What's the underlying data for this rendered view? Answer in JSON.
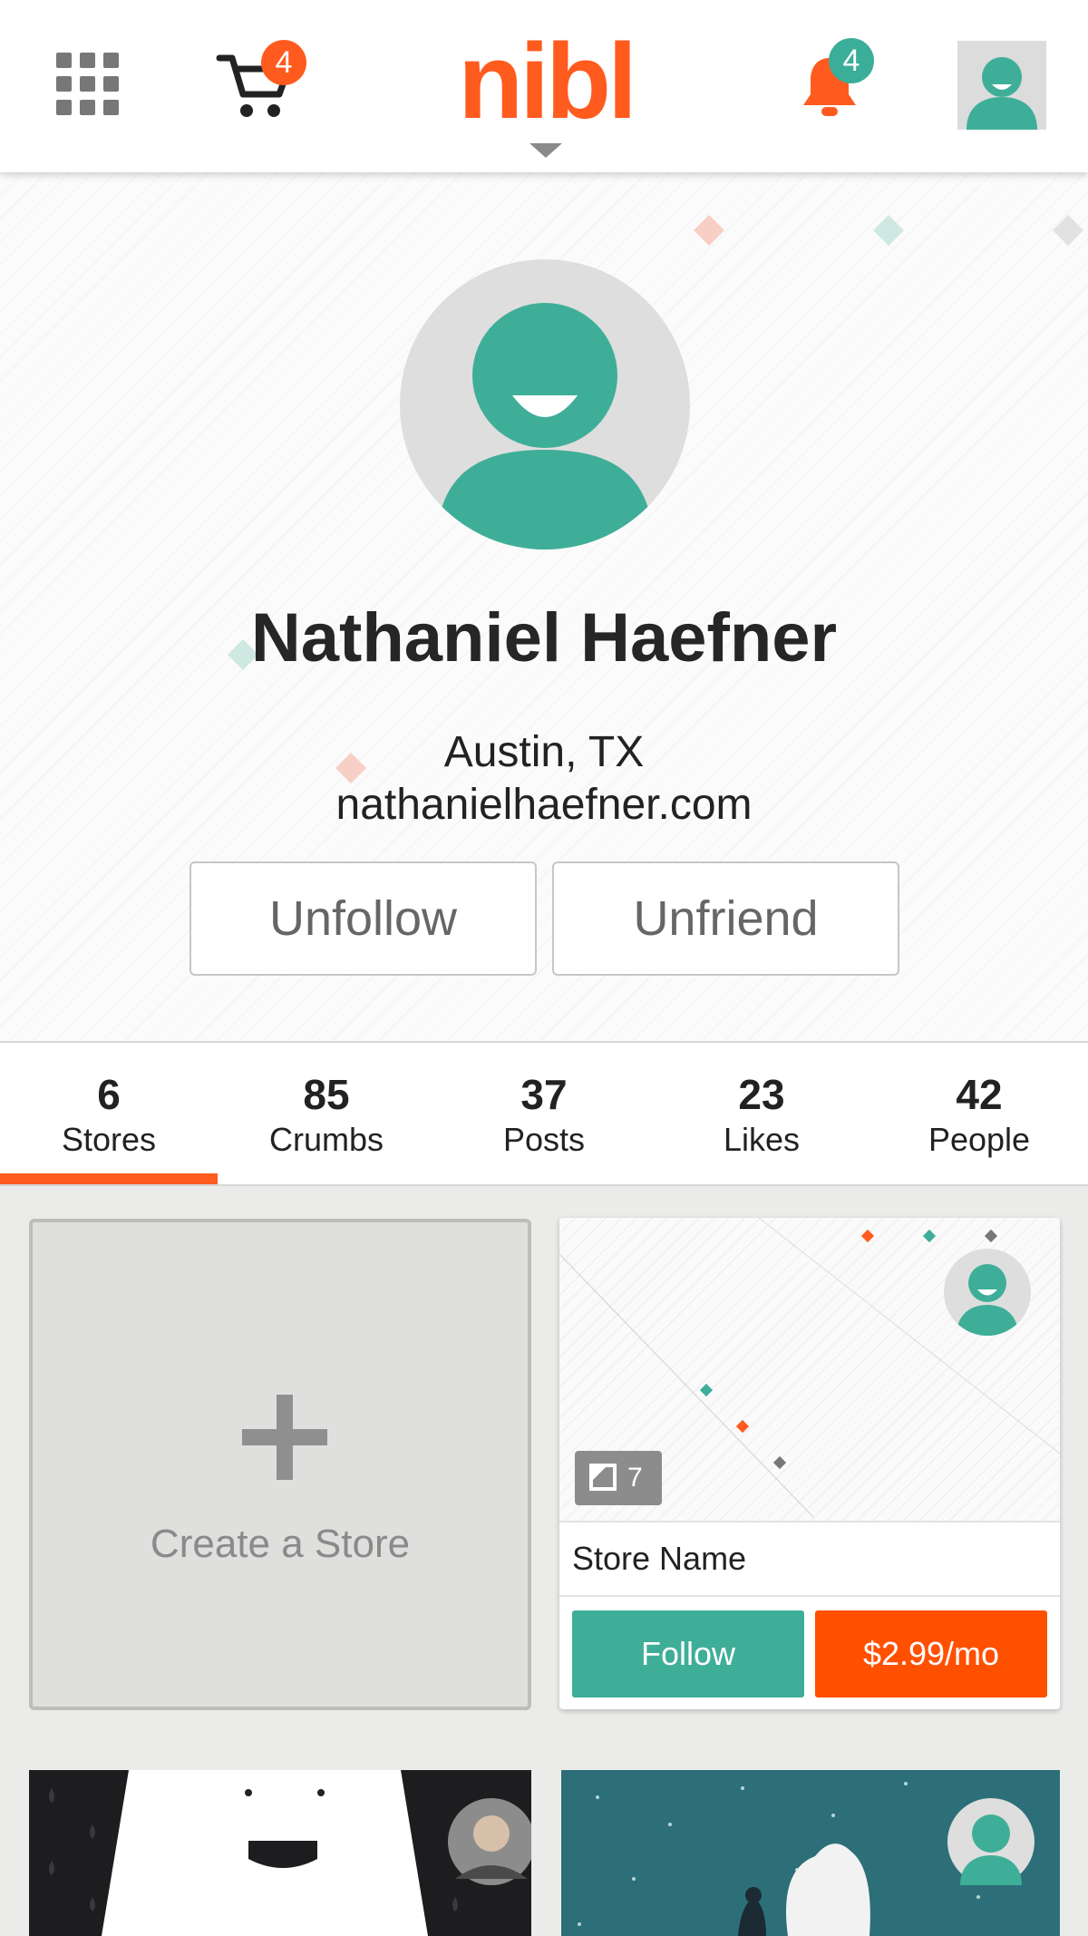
{
  "header": {
    "logo_text": "nibl",
    "cart_count": "4",
    "notification_count": "4",
    "brand_color": "#ff5b1f",
    "accent_color": "#3aae98"
  },
  "profile": {
    "name": "Nathaniel Haefner",
    "location": "Austin, TX",
    "website": "nathanielhaefner.com",
    "unfollow_label": "Unfollow",
    "unfriend_label": "Unfriend"
  },
  "stats": [
    {
      "value": "6",
      "label": "Stores"
    },
    {
      "value": "85",
      "label": "Crumbs"
    },
    {
      "value": "37",
      "label": "Posts"
    },
    {
      "value": "23",
      "label": "Likes"
    },
    {
      "value": "42",
      "label": "People"
    }
  ],
  "active_tab": "Stores",
  "create_store": {
    "label": "Create a Store"
  },
  "store_card": {
    "post_count": "7",
    "name": "Store Name",
    "follow_label": "Follow",
    "price_label": "$2.99/mo"
  }
}
